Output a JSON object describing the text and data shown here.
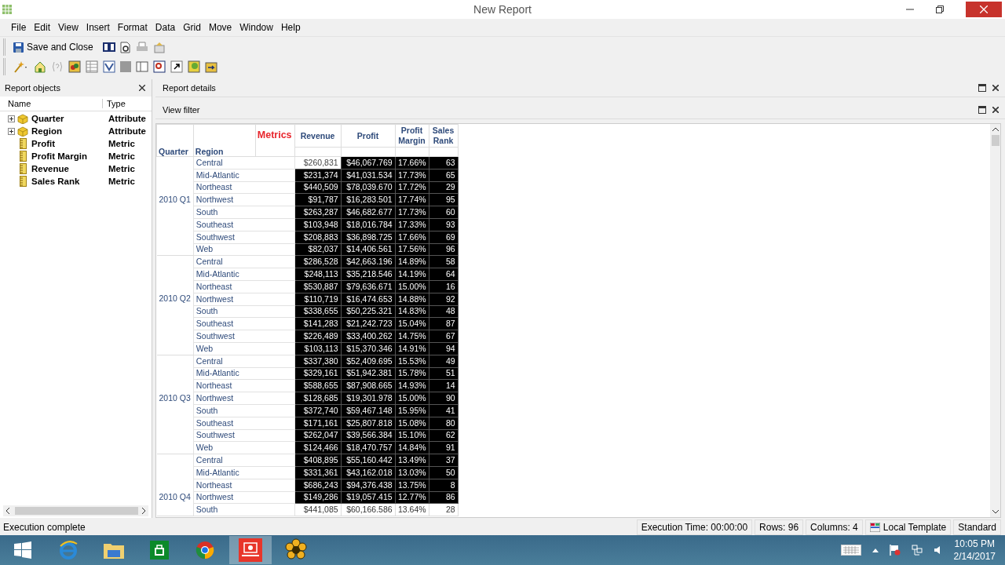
{
  "window": {
    "title": "New Report"
  },
  "menu": [
    {
      "label": "File"
    },
    {
      "label": "Edit"
    },
    {
      "label": "View"
    },
    {
      "label": "Insert"
    },
    {
      "label": "Format"
    },
    {
      "label": "Data"
    },
    {
      "label": "Grid"
    },
    {
      "label": "Move"
    },
    {
      "label": "Window"
    },
    {
      "label": "Help"
    }
  ],
  "toolbar": {
    "save_button": "Save and Close"
  },
  "report_objects": {
    "title": "Report objects",
    "columns": [
      "Name",
      "Type"
    ],
    "items": [
      {
        "name": "Quarter",
        "type": "Attribute",
        "kind": "attribute"
      },
      {
        "name": "Region",
        "type": "Attribute",
        "kind": "attribute"
      },
      {
        "name": "Profit",
        "type": "Metric",
        "kind": "metric"
      },
      {
        "name": "Profit Margin",
        "type": "Metric",
        "kind": "metric"
      },
      {
        "name": "Revenue",
        "type": "Metric",
        "kind": "metric"
      },
      {
        "name": "Sales Rank",
        "type": "Metric",
        "kind": "metric"
      }
    ]
  },
  "panels": [
    {
      "title": "Report details"
    },
    {
      "title": "View filter"
    }
  ],
  "grid": {
    "headers": {
      "quarter": "Quarter",
      "region": "Region",
      "metrics": "Metrics"
    },
    "metric_columns": [
      "Revenue",
      "Profit",
      "Profit Margin",
      "Sales Rank"
    ],
    "groups": [
      {
        "quarter": "2010 Q1",
        "rows": [
          {
            "region": "Central",
            "values": [
              "$260,831",
              "$46,067.769",
              "17.66%",
              "63"
            ],
            "selected": true,
            "focused": true
          },
          {
            "region": "Mid-Atlantic",
            "values": [
              "$231,374",
              "$41,031.534",
              "17.73%",
              "65"
            ],
            "selected": true,
            "focused": false
          },
          {
            "region": "Northeast",
            "values": [
              "$440,509",
              "$78,039.670",
              "17.72%",
              "29"
            ],
            "selected": true,
            "focused": false
          },
          {
            "region": "Northwest",
            "values": [
              "$91,787",
              "$16,283.501",
              "17.74%",
              "95"
            ],
            "selected": true,
            "focused": false
          },
          {
            "region": "South",
            "values": [
              "$263,287",
              "$46,682.677",
              "17.73%",
              "60"
            ],
            "selected": true,
            "focused": false
          },
          {
            "region": "Southeast",
            "values": [
              "$103,948",
              "$18,016.784",
              "17.33%",
              "93"
            ],
            "selected": true,
            "focused": false
          },
          {
            "region": "Southwest",
            "values": [
              "$208,883",
              "$36,898.725",
              "17.66%",
              "69"
            ],
            "selected": true,
            "focused": false
          },
          {
            "region": "Web",
            "values": [
              "$82,037",
              "$14,406.561",
              "17.56%",
              "96"
            ],
            "selected": true,
            "focused": false
          }
        ]
      },
      {
        "quarter": "2010 Q2",
        "rows": [
          {
            "region": "Central",
            "values": [
              "$286,528",
              "$42,663.196",
              "14.89%",
              "58"
            ],
            "selected": true,
            "focused": false
          },
          {
            "region": "Mid-Atlantic",
            "values": [
              "$248,113",
              "$35,218.546",
              "14.19%",
              "64"
            ],
            "selected": true,
            "focused": false
          },
          {
            "region": "Northeast",
            "values": [
              "$530,887",
              "$79,636.671",
              "15.00%",
              "16"
            ],
            "selected": true,
            "focused": false
          },
          {
            "region": "Northwest",
            "values": [
              "$110,719",
              "$16,474.653",
              "14.88%",
              "92"
            ],
            "selected": true,
            "focused": false
          },
          {
            "region": "South",
            "values": [
              "$338,655",
              "$50,225.321",
              "14.83%",
              "48"
            ],
            "selected": true,
            "focused": false
          },
          {
            "region": "Southeast",
            "values": [
              "$141,283",
              "$21,242.723",
              "15.04%",
              "87"
            ],
            "selected": true,
            "focused": false
          },
          {
            "region": "Southwest",
            "values": [
              "$226,489",
              "$33,400.262",
              "14.75%",
              "67"
            ],
            "selected": true,
            "focused": false
          },
          {
            "region": "Web",
            "values": [
              "$103,113",
              "$15,370.346",
              "14.91%",
              "94"
            ],
            "selected": true,
            "focused": false
          }
        ]
      },
      {
        "quarter": "2010 Q3",
        "rows": [
          {
            "region": "Central",
            "values": [
              "$337,380",
              "$52,409.695",
              "15.53%",
              "49"
            ],
            "selected": true,
            "focused": false
          },
          {
            "region": "Mid-Atlantic",
            "values": [
              "$329,161",
              "$51,942.381",
              "15.78%",
              "51"
            ],
            "selected": true,
            "focused": false
          },
          {
            "region": "Northeast",
            "values": [
              "$588,655",
              "$87,908.665",
              "14.93%",
              "14"
            ],
            "selected": true,
            "focused": false
          },
          {
            "region": "Northwest",
            "values": [
              "$128,685",
              "$19,301.978",
              "15.00%",
              "90"
            ],
            "selected": true,
            "focused": false
          },
          {
            "region": "South",
            "values": [
              "$372,740",
              "$59,467.148",
              "15.95%",
              "41"
            ],
            "selected": true,
            "focused": false
          },
          {
            "region": "Southeast",
            "values": [
              "$171,161",
              "$25,807.818",
              "15.08%",
              "80"
            ],
            "selected": true,
            "focused": false
          },
          {
            "region": "Southwest",
            "values": [
              "$262,047",
              "$39,566.384",
              "15.10%",
              "62"
            ],
            "selected": true,
            "focused": false
          },
          {
            "region": "Web",
            "values": [
              "$124,466",
              "$18,470.757",
              "14.84%",
              "91"
            ],
            "selected": true,
            "focused": false
          }
        ]
      },
      {
        "quarter": "2010 Q4",
        "rows": [
          {
            "region": "Central",
            "values": [
              "$408,895",
              "$55,160.442",
              "13.49%",
              "37"
            ],
            "selected": true,
            "focused": false
          },
          {
            "region": "Mid-Atlantic",
            "values": [
              "$331,361",
              "$43,162.018",
              "13.03%",
              "50"
            ],
            "selected": true,
            "focused": false
          },
          {
            "region": "Northeast",
            "values": [
              "$686,243",
              "$94,376.438",
              "13.75%",
              "8"
            ],
            "selected": true,
            "focused": false
          },
          {
            "region": "Northwest",
            "values": [
              "$149,286",
              "$19,057.415",
              "12.77%",
              "86"
            ],
            "selected": true,
            "focused": false
          },
          {
            "region": "South",
            "values": [
              "$441,085",
              "$60,166.586",
              "13.64%",
              "28"
            ],
            "selected": false,
            "focused": false
          }
        ]
      }
    ]
  },
  "status_bar": {
    "message": "Execution complete",
    "execution_time": "Execution Time: 00:00:00",
    "rows": "Rows: 96",
    "columns": "Columns: 4",
    "template": "Local Template",
    "view": "Standard"
  },
  "taskbar": {
    "apps": [
      {
        "kind": "start",
        "selected": false
      },
      {
        "kind": "browser",
        "selected": false
      },
      {
        "kind": "folder",
        "selected": false
      },
      {
        "kind": "store",
        "selected": false
      },
      {
        "kind": "chrome",
        "selected": false
      },
      {
        "kind": "report",
        "selected": true
      },
      {
        "kind": "flower",
        "selected": false
      }
    ],
    "time": "10:05 PM",
    "date": "2/14/2017"
  }
}
